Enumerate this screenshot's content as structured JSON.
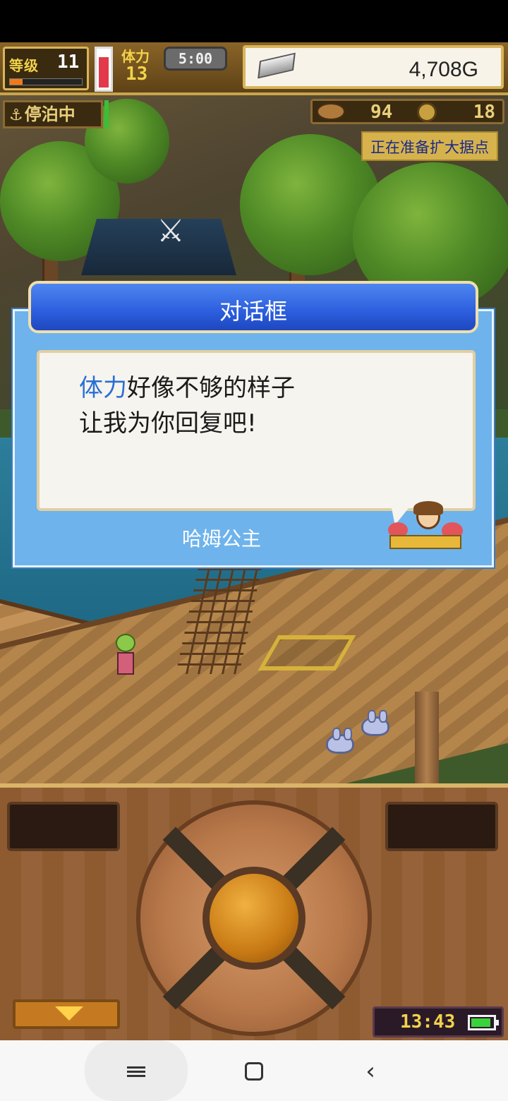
{
  "hud": {
    "level_label": "等级",
    "level_value": "11",
    "xp_progress_percent": 18,
    "stamina_label": "体力",
    "stamina_value": "13",
    "stamina_gauge_percent": 85,
    "timer": "5:00",
    "gold_icon": "silver-ingot-icon",
    "gold": "4,708G",
    "anchor_status": "停泊中",
    "resource_1_icon": "food-icon",
    "resource_1_value": "94",
    "resource_2_icon": "coin-icon",
    "resource_2_value": "18",
    "notice": "正在准备扩大据点"
  },
  "dialog": {
    "title": "对话框",
    "message_highlight": "体力",
    "message_line1_rest": "好像不够的样子",
    "message_line2": "让我为你回复吧!",
    "speaker_name": "哈姆公主"
  },
  "controls": {
    "clock": "13:43",
    "battery_percent": 90,
    "menu_arrow_icon": "chevron-down-icon"
  },
  "nav": {
    "menu_icon": "menu-icon",
    "home_icon": "home-icon",
    "back_icon": "back-icon",
    "back_glyph": "‹"
  },
  "colors": {
    "dialog_header": "#2c5ede",
    "dialog_body": "#6eb3ec",
    "highlight_text": "#2a6fd4",
    "hud_gold_text": "#f2d24a"
  }
}
